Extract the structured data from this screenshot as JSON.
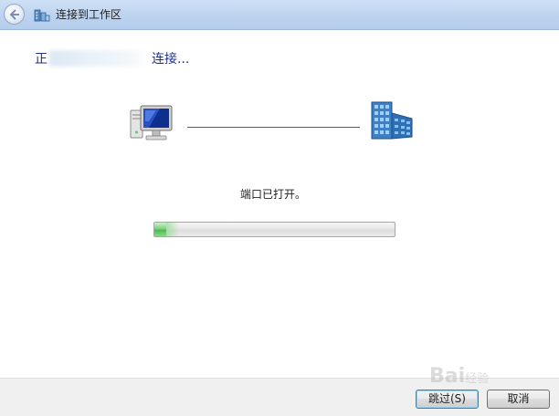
{
  "window": {
    "title": "连接到工作区"
  },
  "content": {
    "heading_prefix": "正",
    "heading_suffix": "连接...",
    "status_text": "端口已打开。",
    "progress": 0.05
  },
  "footer": {
    "skip_label": "跳过(S)",
    "cancel_label": "取消"
  },
  "watermark": {
    "text": "Bai",
    "suffix": "经验"
  },
  "icons": {
    "back": "back-arrow-icon",
    "title": "workplace-connection-icon",
    "computer": "computer-icon",
    "server": "server-building-icon"
  },
  "colors": {
    "heading": "#1e3287",
    "titlebar": "#bcd3ef",
    "progress_fill": "#4cbb4c"
  }
}
